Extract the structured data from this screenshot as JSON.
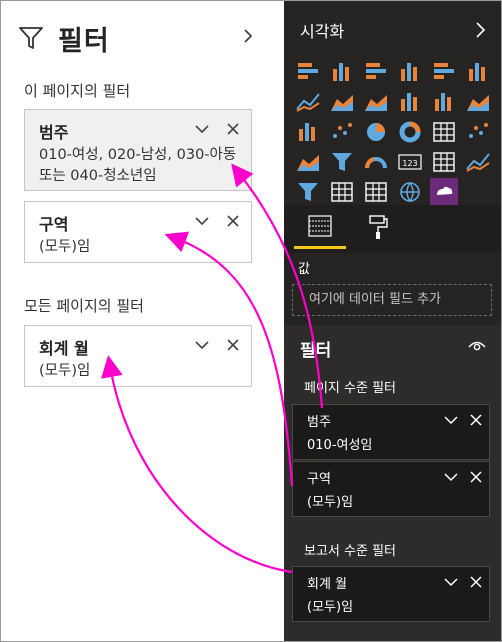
{
  "left_pane": {
    "title": "필터",
    "this_page_label": "이 페이지의 필터",
    "all_pages_label": "모든 페이지의 필터",
    "cards": [
      {
        "title": "범주",
        "value": "010-여성, 020-남성, 030-아동 또는 040-청소년임"
      },
      {
        "title": "구역",
        "value": "(모두)임"
      },
      {
        "title": "회계 월",
        "value": "(모두)임"
      }
    ]
  },
  "right_pane": {
    "visualizations_title": "시각화",
    "values_label": "값",
    "values_placeholder": "여기에 데이터 필드 추가",
    "filters_title": "필터",
    "page_level_label": "페이지 수준 필터",
    "report_level_label": "보고서 수준 필터",
    "cards": [
      {
        "title": "범주",
        "value": "010-여성임"
      },
      {
        "title": "구역",
        "value": "(모두)임"
      },
      {
        "title": "회계 월",
        "value": "(모두)임"
      }
    ]
  },
  "colors": {
    "accent_yellow": "#f2c811",
    "arrow_magenta": "#ff00cc",
    "viz_orange": "#e8833a",
    "viz_blue": "#5fa8e0",
    "dark_bg": "#252423"
  },
  "visualization_icons": [
    "stacked-bar-icon",
    "stacked-column-icon",
    "clustered-bar-icon",
    "clustered-column-icon",
    "100-percent-bar-icon",
    "100-percent-column-icon",
    "line-chart-icon",
    "area-chart-icon",
    "stacked-area-icon",
    "line-column-icon",
    "line-clustered-column-icon",
    "ribbon-chart-icon",
    "waterfall-icon",
    "scatter-icon",
    "pie-icon",
    "donut-icon",
    "treemap-icon",
    "map-icon",
    "filled-map-icon",
    "funnel-icon",
    "gauge-icon",
    "card-icon",
    "multi-row-card-icon",
    "kpi-icon",
    "slicer-icon",
    "table-icon",
    "matrix-icon",
    "globe-icon",
    "custom-visual-icon"
  ]
}
